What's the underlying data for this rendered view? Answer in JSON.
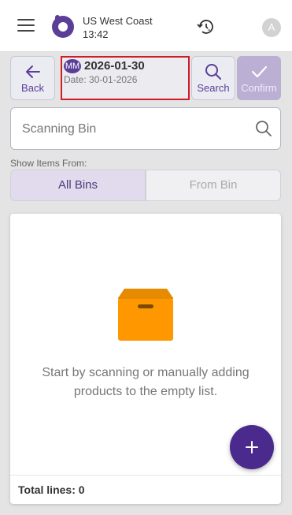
{
  "header": {
    "location": "US West Coast",
    "time": "13:42",
    "avatar_initial": "A",
    "icons": [
      "menu-icon",
      "app-logo",
      "sync-history-icon"
    ]
  },
  "toolbar": {
    "back_label": "Back",
    "search_label": "Search",
    "confirm_label": "Confirm",
    "doc": {
      "badge": "MM",
      "title": "2026-01-30",
      "date_line": "Date: 30-01-2026"
    }
  },
  "scan": {
    "placeholder": "Scanning Bin",
    "value": ""
  },
  "filter": {
    "label": "Show Items From:",
    "options": [
      "All Bins",
      "From Bin"
    ],
    "selected": "All Bins"
  },
  "list": {
    "empty_message": "Start by scanning or manually adding products to the empty list.",
    "total_label": "Total lines: 0",
    "empty_icon": "package-box-icon"
  },
  "colors": {
    "brand_purple": "#5a3e98",
    "fab_purple": "#4a2a8c",
    "highlight_red": "#d01c26",
    "box_orange": "#ff9800"
  }
}
